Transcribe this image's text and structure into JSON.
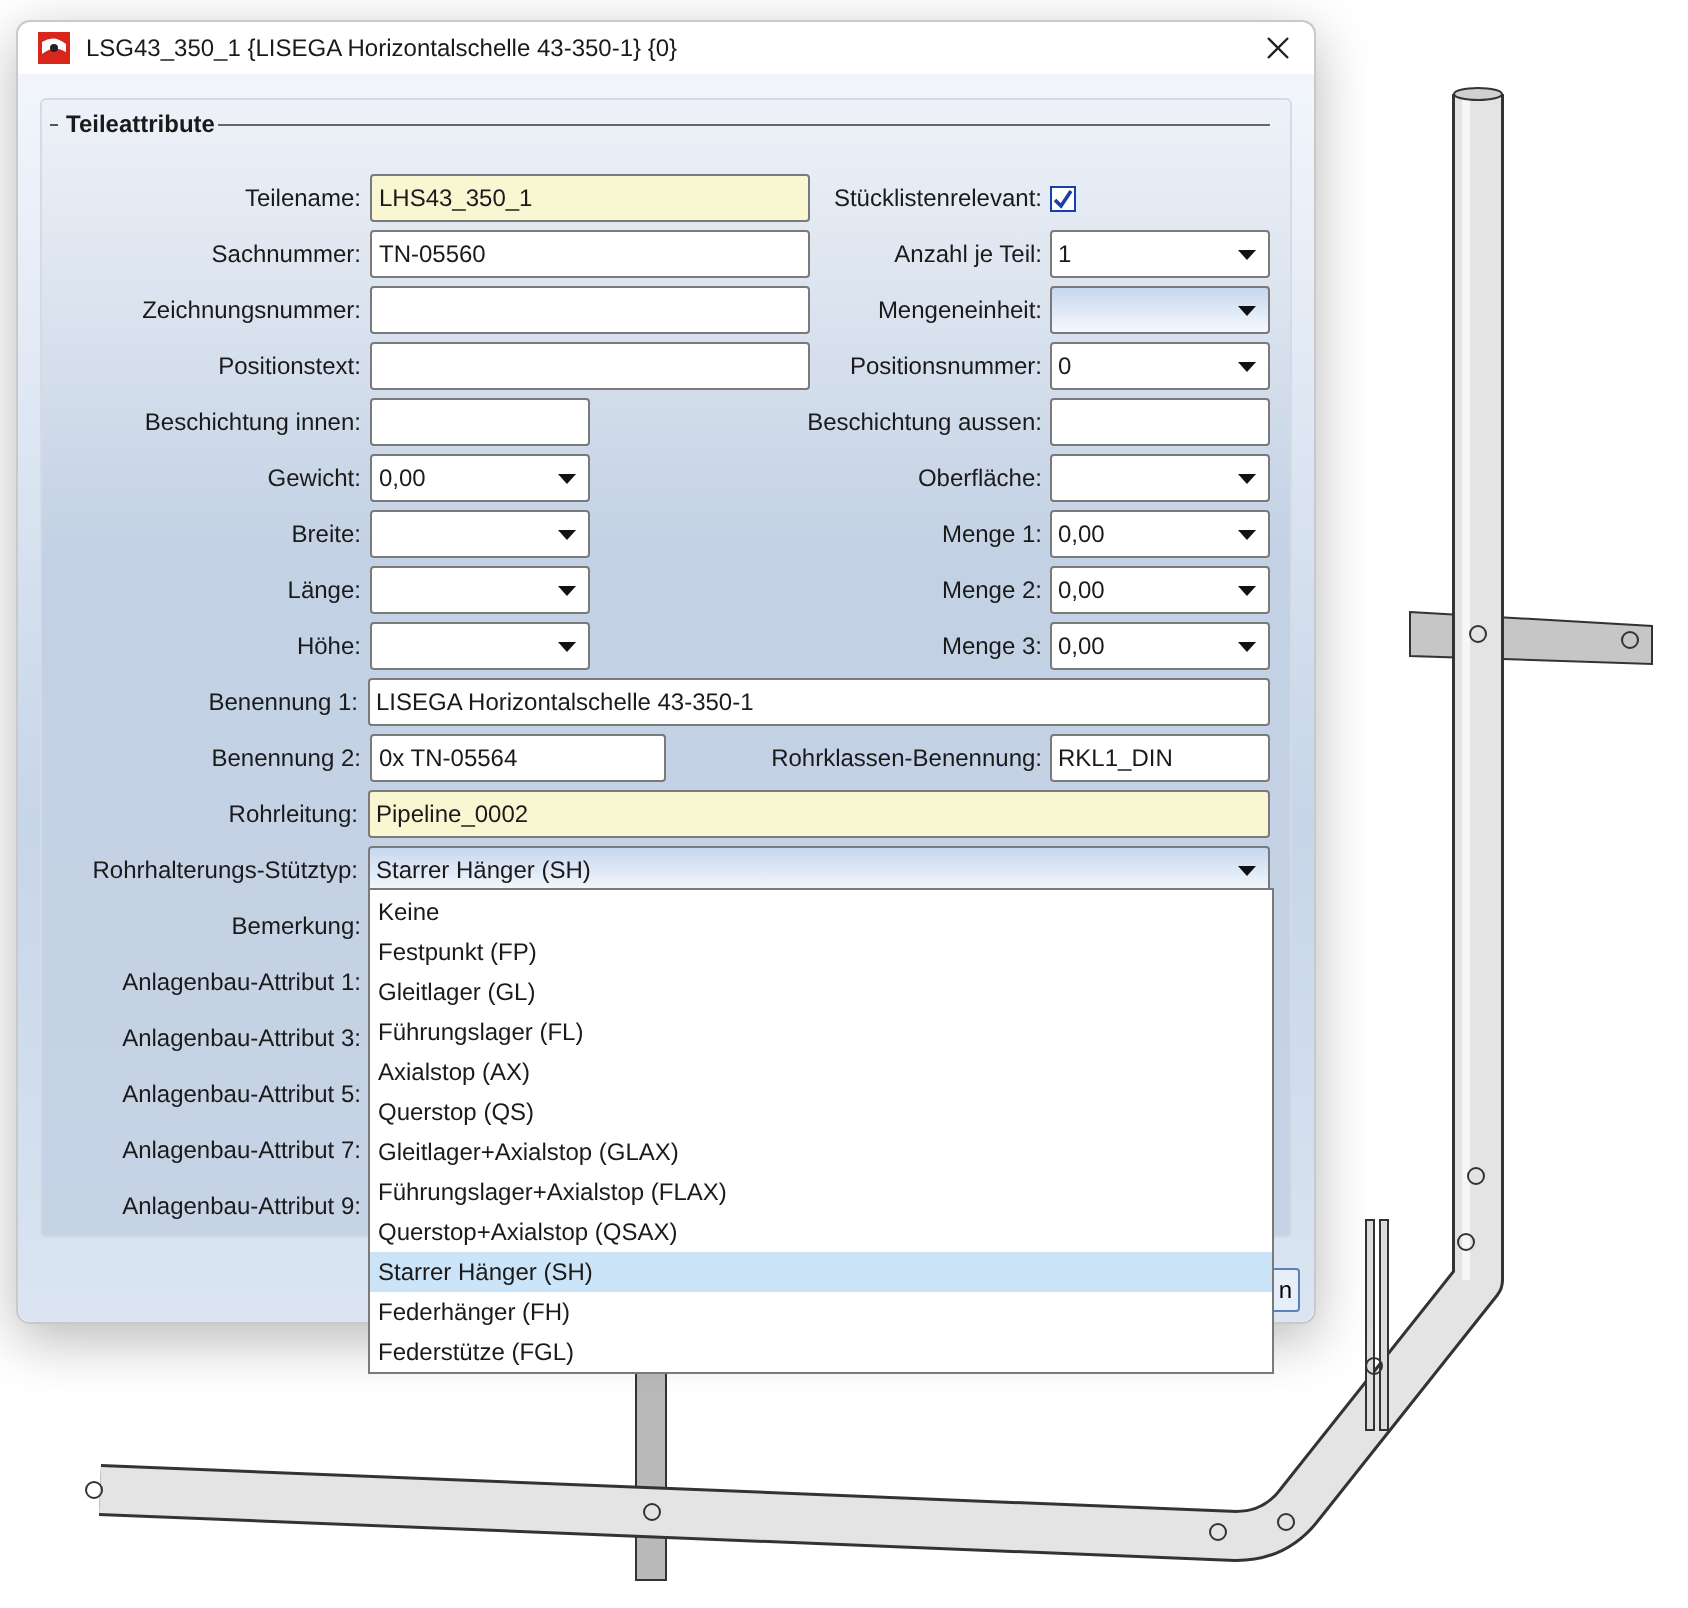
{
  "window": {
    "title": "LSG43_350_1 {LISEGA Horizontalschelle 43-350-1} {0}"
  },
  "group": {
    "title": "Teileattribute"
  },
  "rows": [
    {
      "left": {
        "label": "Teilename:",
        "kind": "text",
        "value": "LHS43_350_1",
        "required": true
      },
      "right": {
        "label": "Stücklistenrelevant:",
        "kind": "checkbox",
        "checked": true
      }
    },
    {
      "left": {
        "label": "Sachnummer:",
        "kind": "text",
        "value": "TN-05560",
        "required": false
      },
      "right": {
        "label": "Anzahl je Teil:",
        "kind": "combo",
        "value": "1",
        "active": false
      }
    },
    {
      "left": {
        "label": "Zeichnungsnummer:",
        "kind": "text",
        "required": false
      },
      "right": {
        "label": "Mengeneinheit:",
        "kind": "combo",
        "active": true
      }
    },
    {
      "left": {
        "label": "Positionstext:",
        "kind": "text",
        "required": false
      },
      "right": {
        "label": "Positionsnummer:",
        "kind": "combo",
        "value": "0",
        "active": false
      }
    },
    {
      "left": {
        "label": "Beschichtung innen:",
        "kind": "text",
        "required": false
      },
      "right": {
        "label": "Beschichtung aussen:",
        "kind": "text",
        "required": false
      }
    },
    {
      "left": {
        "label": "Gewicht:",
        "kind": "combo",
        "value": "0,00",
        "active": false
      },
      "right": {
        "label": "Oberfläche:",
        "kind": "combo",
        "active": false
      }
    },
    {
      "left": {
        "label": "Breite:",
        "kind": "combo",
        "active": false
      },
      "right": {
        "label": "Menge 1:",
        "kind": "combo",
        "value": "0,00",
        "active": false
      }
    },
    {
      "left": {
        "label": "Länge:",
        "kind": "combo",
        "active": false
      },
      "right": {
        "label": "Menge 2:",
        "kind": "combo",
        "value": "0,00",
        "active": false
      }
    },
    {
      "left": {
        "label": "Höhe:",
        "kind": "combo",
        "active": false
      },
      "right": {
        "label": "Menge 3:",
        "kind": "combo",
        "value": "0,00",
        "active": false
      }
    },
    {
      "left": {
        "label": "Benennung 1:",
        "kind": "text",
        "value": "LISEGA Horizontalschelle 43-350-1",
        "required": false
      }
    },
    {
      "left": {
        "label": "Benennung 2:",
        "kind": "text",
        "value": "0x TN-05564",
        "required": false
      },
      "right": {
        "label": "Rohrklassen-Benennung:",
        "kind": "text",
        "value": "RKL1_DIN",
        "required": false
      }
    },
    {
      "left": {
        "label": "Rohrleitung:",
        "kind": "text",
        "value": "Pipeline_0002",
        "required": true
      }
    },
    {
      "left": {
        "label": "Rohrhalterungs-Stütztyp:",
        "kind": "combo",
        "value": "Starrer Hänger (SH)",
        "active": true
      }
    },
    {
      "left": {
        "label": "Bemerkung:"
      }
    },
    {
      "left": {
        "label": "Anlagenbau-Attribut 1:"
      }
    },
    {
      "left": {
        "label": "Anlagenbau-Attribut 3:"
      }
    },
    {
      "left": {
        "label": "Anlagenbau-Attribut 5:"
      }
    },
    {
      "left": {
        "label": "Anlagenbau-Attribut 7:"
      }
    },
    {
      "left": {
        "label": "Anlagenbau-Attribut 9:"
      }
    }
  ],
  "dropdown": {
    "options": [
      {
        "label": "Keine",
        "selected": false
      },
      {
        "label": "Festpunkt (FP)",
        "selected": false
      },
      {
        "label": "Gleitlager (GL)",
        "selected": false
      },
      {
        "label": "Führungslager (FL)",
        "selected": false
      },
      {
        "label": "Axialstop (AX)",
        "selected": false
      },
      {
        "label": "Querstop (QS)",
        "selected": false
      },
      {
        "label": "Gleitlager+Axialstop (GLAX)",
        "selected": false
      },
      {
        "label": "Führungslager+Axialstop (FLAX)",
        "selected": false
      },
      {
        "label": "Querstop+Axialstop (QSAX)",
        "selected": false
      },
      {
        "label": "Starrer Hänger (SH)",
        "selected": true
      },
      {
        "label": "Federhänger (FH)",
        "selected": false
      },
      {
        "label": "Federstütze (FGL)",
        "selected": false
      }
    ]
  },
  "footer_button": {
    "label": "n"
  }
}
